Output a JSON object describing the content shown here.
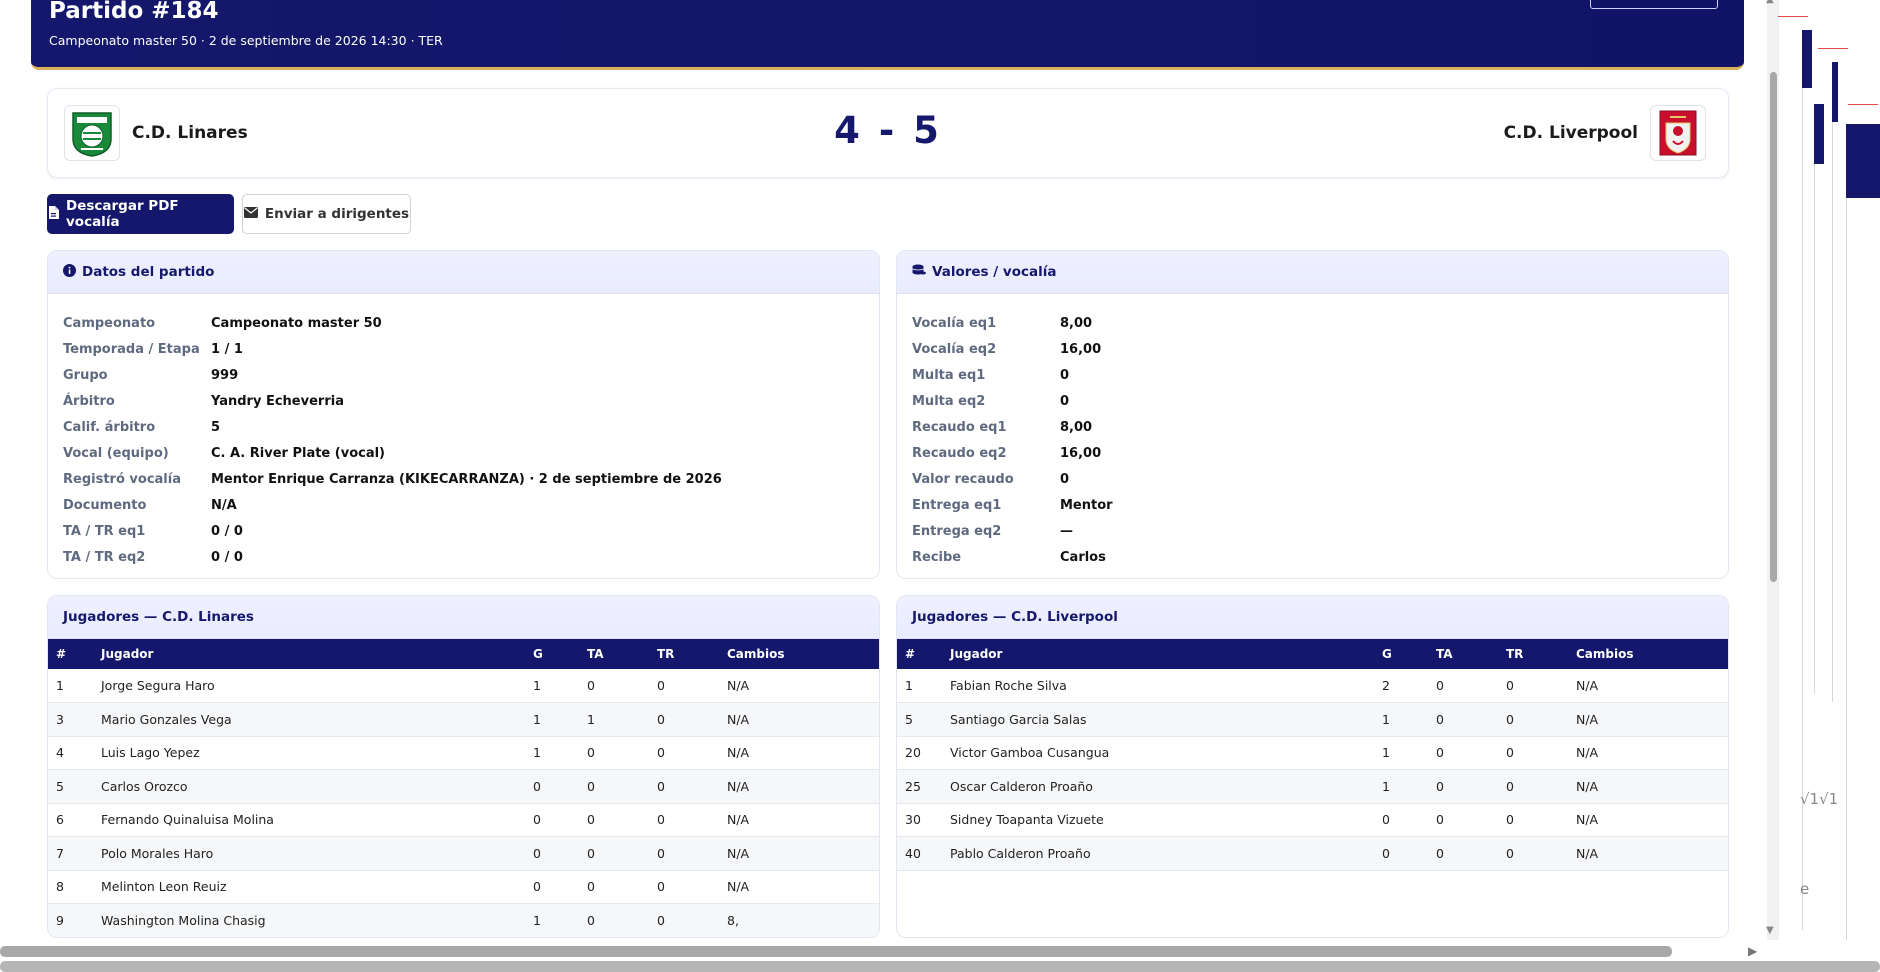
{
  "header": {
    "title": "Partido #184",
    "subtitle": "Campeonato master 50 · 2 de septiembre de 2026 14:30 · TER"
  },
  "match": {
    "home_team": "C.D. Linares",
    "away_team": "C.D. Liverpool",
    "home_score": "4",
    "separator": "-",
    "away_score": "5"
  },
  "actions": {
    "download_pdf": "Descargar PDF vocalía",
    "send_leaders": "Enviar a dirigentes"
  },
  "datos": {
    "title": "Datos del partido",
    "rows": [
      {
        "label": "Campeonato",
        "value": "Campeonato master 50"
      },
      {
        "label": "Temporada / Etapa",
        "value": "1 / 1"
      },
      {
        "label": "Grupo",
        "value": "999"
      },
      {
        "label": "Árbitro",
        "value": "Yandry Echeverria"
      },
      {
        "label": "Calif. árbitro",
        "value": "5"
      },
      {
        "label": "Vocal (equipo)",
        "value": "C. A. River Plate (vocal)"
      },
      {
        "label": "Registró vocalía",
        "value": "Mentor Enrique Carranza (KIKECARRANZA) · 2 de septiembre de 2026"
      },
      {
        "label": "Documento",
        "value": "N/A"
      },
      {
        "label": "TA / TR eq1",
        "value": "0 / 0"
      },
      {
        "label": "TA / TR eq2",
        "value": "0 / 0"
      }
    ]
  },
  "valores": {
    "title": "Valores / vocalía",
    "rows": [
      {
        "label": "Vocalía eq1",
        "value": "8,00"
      },
      {
        "label": "Vocalía eq2",
        "value": "16,00"
      },
      {
        "label": "Multa eq1",
        "value": "0"
      },
      {
        "label": "Multa eq2",
        "value": "0"
      },
      {
        "label": "Recaudo eq1",
        "value": "8,00"
      },
      {
        "label": "Recaudo eq2",
        "value": "16,00"
      },
      {
        "label": "Valor recaudo",
        "value": "0"
      },
      {
        "label": "Entrega eq1",
        "value": "Mentor"
      },
      {
        "label": "Entrega eq2",
        "value": "—"
      },
      {
        "label": "Recibe",
        "value": "Carlos"
      }
    ]
  },
  "columns": [
    "#",
    "Jugador",
    "G",
    "TA",
    "TR",
    "Cambios"
  ],
  "players_home": {
    "title": "Jugadores — C.D. Linares",
    "rows": [
      [
        "1",
        "Jorge Segura Haro",
        "1",
        "0",
        "0",
        "N/A"
      ],
      [
        "3",
        "Mario Gonzales Vega",
        "1",
        "1",
        "0",
        "N/A"
      ],
      [
        "4",
        "Luis Lago Yepez",
        "1",
        "0",
        "0",
        "N/A"
      ],
      [
        "5",
        "Carlos Orozco",
        "0",
        "0",
        "0",
        "N/A"
      ],
      [
        "6",
        "Fernando Quinaluisa Molina",
        "0",
        "0",
        "0",
        "N/A"
      ],
      [
        "7",
        "Polo Morales Haro",
        "0",
        "0",
        "0",
        "N/A"
      ],
      [
        "8",
        "Melinton Leon Reuiz",
        "0",
        "0",
        "0",
        "N/A"
      ],
      [
        "9",
        "Washington Molina Chasig",
        "1",
        "0",
        "0",
        "8,"
      ]
    ]
  },
  "players_away": {
    "title": "Jugadores — C.D. Liverpool",
    "rows": [
      [
        "1",
        "Fabian Roche Silva",
        "2",
        "0",
        "0",
        "N/A"
      ],
      [
        "5",
        "Santiago Garcia Salas",
        "1",
        "0",
        "0",
        "N/A"
      ],
      [
        "20",
        "Victor Gamboa Cusangua",
        "1",
        "0",
        "0",
        "N/A"
      ],
      [
        "25",
        "Oscar Calderon Proaño",
        "1",
        "0",
        "0",
        "N/A"
      ],
      [
        "30",
        "Sidney Toapanta Vizuete",
        "0",
        "0",
        "0",
        "N/A"
      ],
      [
        "40",
        "Pablo Calderon Proaño",
        "0",
        "0",
        "0",
        "N/A"
      ]
    ]
  },
  "ghost": {
    "text1": "√1√1",
    "text2": "e"
  },
  "colors": {
    "primary": "#14176b",
    "accent_border": "#d9b25a",
    "card_header_bg": "#eef0ff"
  }
}
